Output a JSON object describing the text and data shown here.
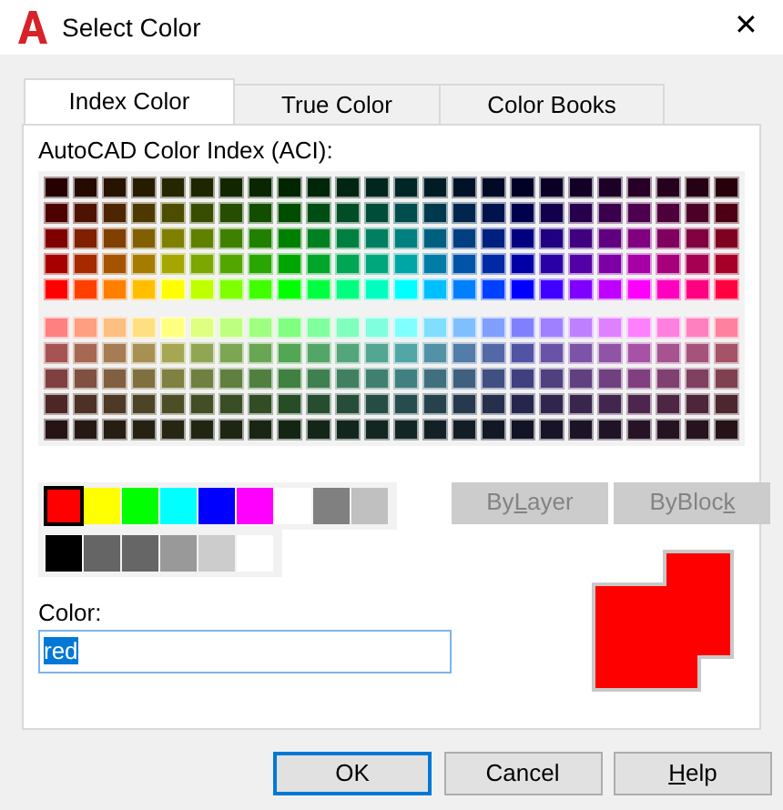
{
  "window": {
    "title": "Select Color",
    "close": "✕"
  },
  "tabs": [
    {
      "label": "Index Color",
      "selected": true
    },
    {
      "label": "True Color",
      "selected": false
    },
    {
      "label": "Color Books",
      "selected": false
    }
  ],
  "palette_label": "AutoCAD Color Index (ACI):",
  "standard_colors": [
    {
      "color": "#ff0000",
      "selected": true
    },
    {
      "color": "#ffff00",
      "selected": false
    },
    {
      "color": "#00ff00",
      "selected": false
    },
    {
      "color": "#00ffff",
      "selected": false
    },
    {
      "color": "#0000ff",
      "selected": false
    },
    {
      "color": "#ff00ff",
      "selected": false
    },
    {
      "color": "#ffffff",
      "selected": false
    },
    {
      "color": "#808080",
      "selected": false
    },
    {
      "color": "#c0c0c0",
      "selected": false
    }
  ],
  "gray_colors": [
    {
      "color": "#000000",
      "selected": false
    },
    {
      "color": "#656565",
      "selected": false
    },
    {
      "color": "#666666",
      "selected": false
    },
    {
      "color": "#999999",
      "selected": false
    },
    {
      "color": "#cccccc",
      "selected": false
    },
    {
      "color": "#ffffff",
      "selected": false
    }
  ],
  "by_buttons": [
    {
      "before": "By",
      "key": "L",
      "after": "ayer",
      "disabled": true
    },
    {
      "before": "ByBloc",
      "key": "k",
      "disabled": true
    }
  ],
  "color_field": {
    "label": "Color:",
    "value": "red"
  },
  "preview": {
    "color": "#ff0000"
  },
  "buttons": [
    {
      "after": "OK",
      "default": true
    },
    {
      "after": "Cancel",
      "default": false
    },
    {
      "key": "H",
      "after": "elp",
      "default": false
    }
  ]
}
